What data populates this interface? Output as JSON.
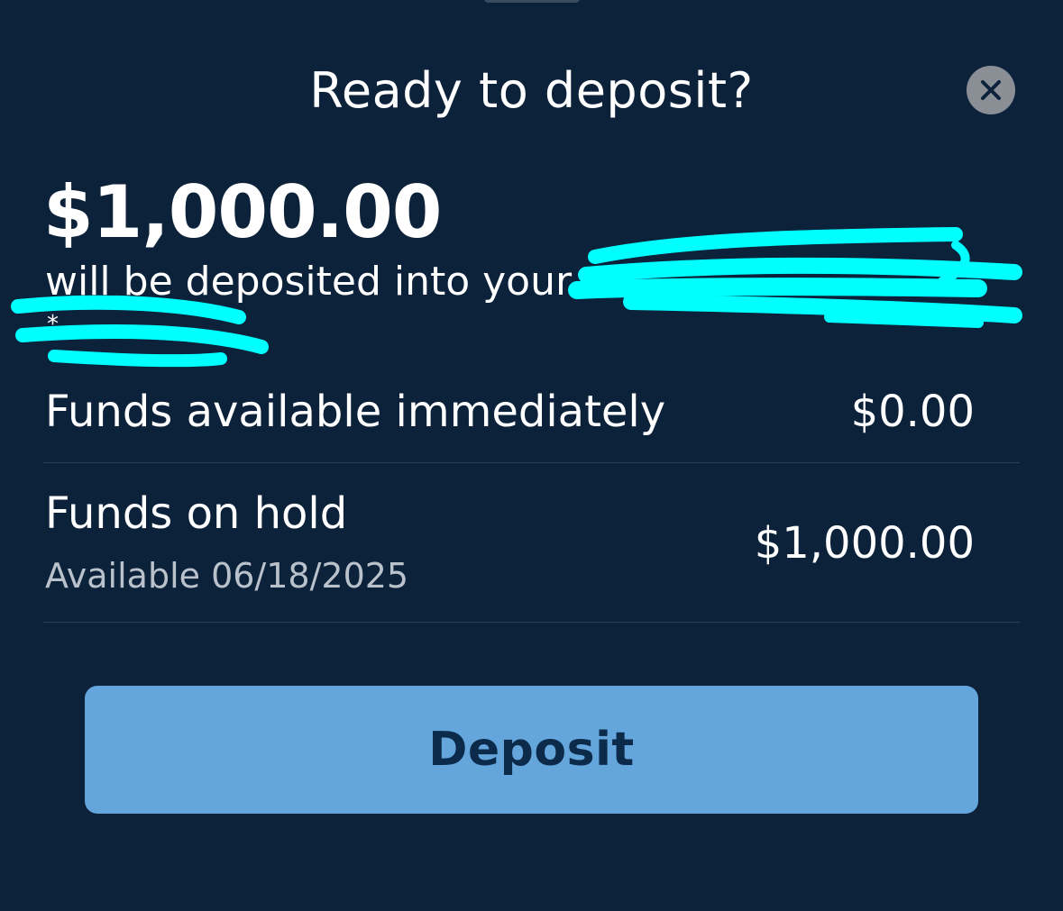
{
  "sheet": {
    "title": "Ready to deposit?",
    "close_icon": "close-icon"
  },
  "summary": {
    "amount": "$1,000.00",
    "deposit_text": "will be deposited into your",
    "account_suffix": "*"
  },
  "funds": [
    {
      "label": "Funds available immediately",
      "value": "$0.00"
    },
    {
      "label": "Funds on hold",
      "sublabel": "Available 06/18/2025",
      "value": "$1,000.00"
    }
  ],
  "actions": {
    "deposit_label": "Deposit"
  },
  "colors": {
    "background": "#0c223a",
    "button": "#64a5dc",
    "button_text": "#0c2a4a",
    "redaction": "#00ffff"
  }
}
